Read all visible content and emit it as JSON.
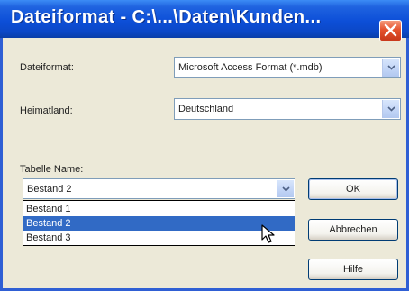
{
  "window": {
    "title": "Dateiformat - C:\\...\\Daten\\Kunden..."
  },
  "fields": {
    "dateiformat_label": "Dateiformat:",
    "dateiformat_value": "Microsoft Access Format (*.mdb)",
    "heimatland_label": "Heimatland:",
    "heimatland_value": "Deutschland",
    "tabelle_label": "Tabelle Name:",
    "tabelle_value": "Bestand 2"
  },
  "dropdown": {
    "items": [
      "Bestand 1",
      "Bestand 2",
      "Bestand 3"
    ],
    "selected": "Bestand 2"
  },
  "buttons": {
    "ok": "OK",
    "cancel": "Abbrechen",
    "help": "Hilfe"
  },
  "icons": {
    "close": "close-icon",
    "dropdown_arrow": "chevron-down-icon",
    "cursor": "mouse-pointer-icon"
  },
  "colors": {
    "titlebar": "#0d4fd8",
    "selection": "#316ac5",
    "close_button": "#e5532e"
  }
}
